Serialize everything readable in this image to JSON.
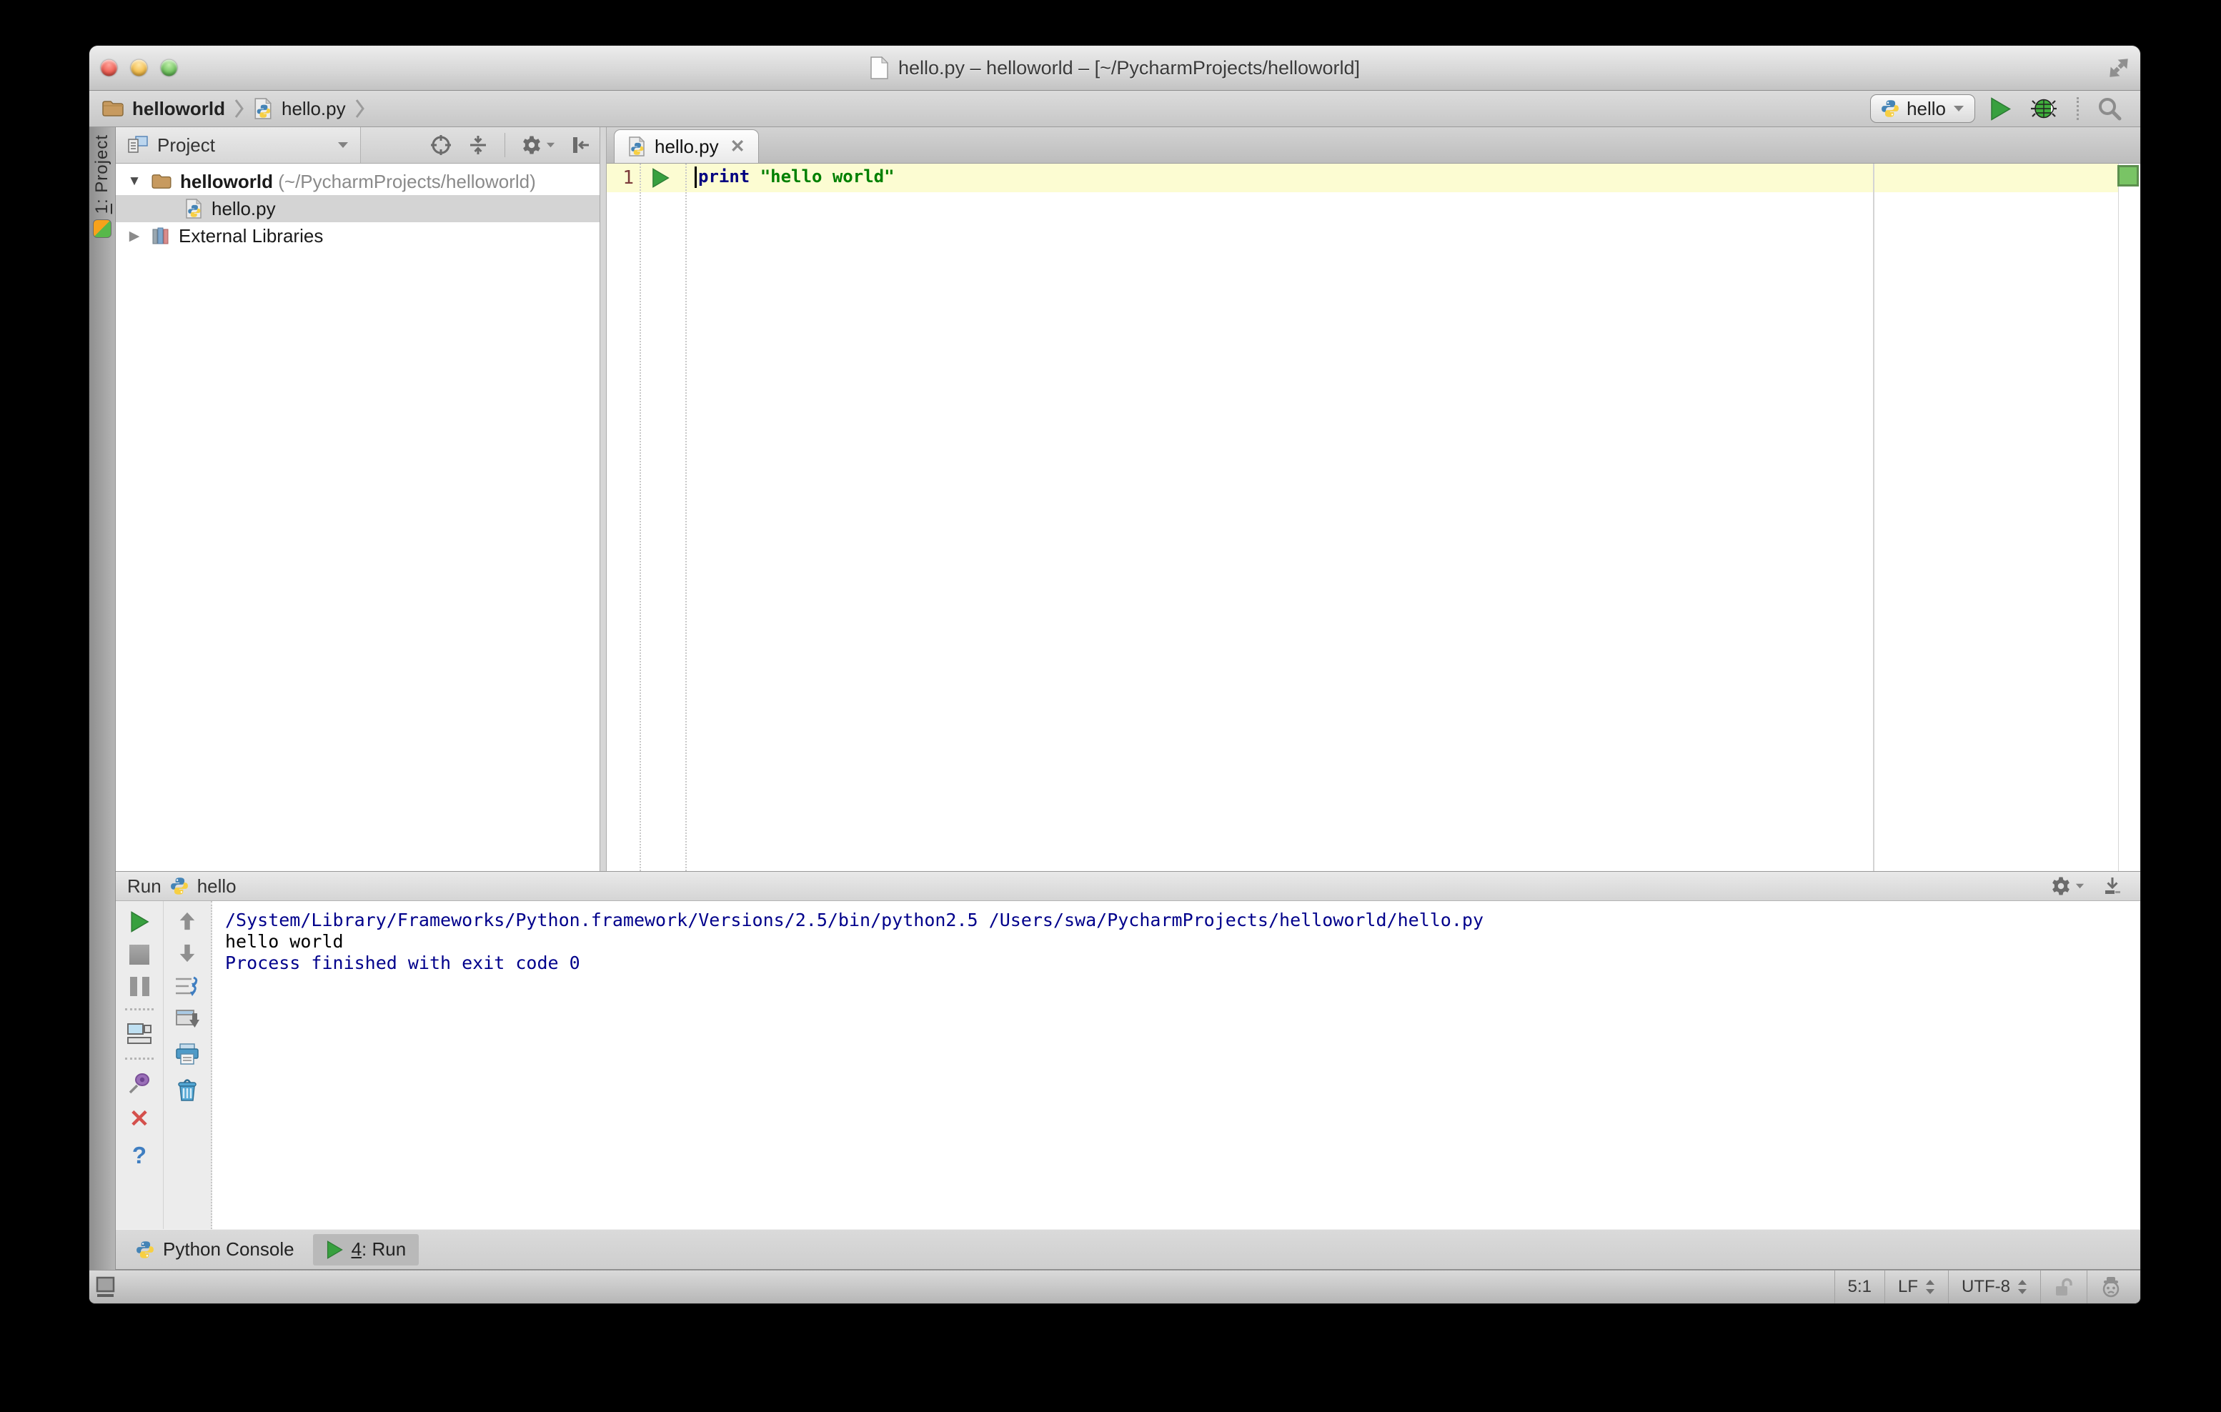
{
  "window": {
    "title": "hello.py – helloworld – [~/PycharmProjects/helloworld]"
  },
  "icons": {
    "close": "✕",
    "help": "?",
    "caret_down": "▼",
    "caret_right": "▶"
  },
  "navbar": {
    "breadcrumb_project": "helloworld",
    "breadcrumb_file": "hello.py",
    "run_config": "hello"
  },
  "tool_strip": {
    "project_number": "1",
    "project_label": ": Project"
  },
  "project_panel": {
    "header_label": "Project",
    "root_name": "helloworld",
    "root_path": "(~/PycharmProjects/helloworld)",
    "file_name": "hello.py",
    "libraries_label": "External Libraries"
  },
  "editor": {
    "tab_label": "hello.py",
    "line_number": "1",
    "code_keyword": "print",
    "code_string": "\"hello world\""
  },
  "run_panel": {
    "title": "Run",
    "config_name": "hello",
    "console_lines": [
      {
        "text": "/System/Library/Frameworks/Python.framework/Versions/2.5/bin/python2.5 /Users/swa/PycharmProjects/helloworld/hello.py"
      },
      {
        "text": "hello world"
      },
      {
        "text": ""
      },
      {
        "text": "Process finished with exit code 0"
      }
    ]
  },
  "toolwindow_bar": {
    "python_console_label": "Python Console",
    "run_number": "4",
    "run_label": ": Run"
  },
  "status_bar": {
    "caret_position": "5:1",
    "line_separator": "LF",
    "encoding": "UTF-8"
  },
  "colors": {
    "run_green": "#38a03f",
    "keyword_blue": "#000080",
    "string_green": "#008000",
    "console_navy": "#00008b",
    "current_line": "#fcfcd2"
  }
}
